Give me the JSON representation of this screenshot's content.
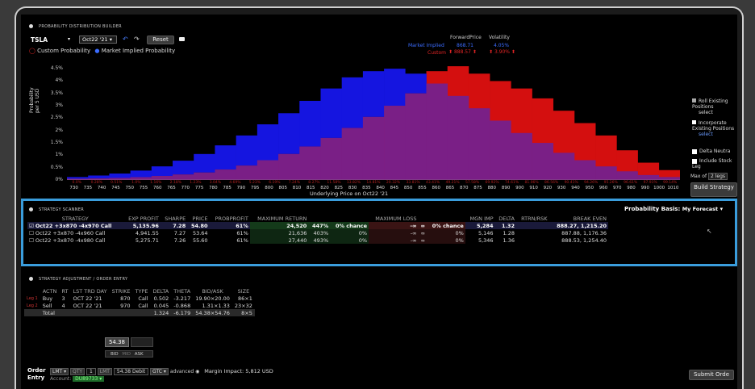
{
  "builder": {
    "header": "PROBABILITY DISTRIBUTION BUILDER",
    "symbol": "TSLA",
    "expiry": "Oct22 '21",
    "reset_label": "Reset",
    "legend_custom": "Custom Probability",
    "legend_market": "Market Implied Probability",
    "forward_price_label": "ForwardPrice",
    "volatility_label": "Volatility",
    "market_implied_label": "Market Implied",
    "market_forward": "868.71",
    "market_vol": "4.05%",
    "custom_label": "Custom",
    "custom_forward": "888.57",
    "custom_vol": "3.90%",
    "ylabel": "Probability\nper 5 USD",
    "xlabel": "Underlying Price on Oct22 '21",
    "side_options": [
      {
        "label": "Roll Existing Positions",
        "link": "select"
      },
      {
        "label": "Incorporate Existing Positions",
        "link": "select"
      }
    ],
    "delta_neutral": "Delta Neutra",
    "include_stock": "Include Stock Leg",
    "max_of": "Max of",
    "max_legs": "2 legs",
    "build_label": "Build Strategy"
  },
  "chart_data": {
    "type": "bar",
    "y_ticks": [
      "4.5%",
      "4%",
      "3.5%",
      "3%",
      "2.5%",
      "2%",
      "1.5%",
      "1%",
      "0.5%",
      "0%"
    ],
    "ylim": [
      0,
      4.7
    ],
    "x_labels": [
      "730",
      "735",
      "740",
      "745",
      "750",
      "755",
      "760",
      "765",
      "770",
      "775",
      "780",
      "785",
      "790",
      "795",
      "800",
      "805",
      "810",
      "815",
      "820",
      "825",
      "830",
      "835",
      "840",
      "845",
      "850",
      "855",
      "860",
      "865",
      "870",
      "875",
      "880",
      "890",
      "900",
      "910",
      "920",
      "930",
      "940",
      "950",
      "960",
      "970",
      "980",
      "990",
      "1000",
      "1010"
    ],
    "categories": [
      "730",
      "740",
      "750",
      "760",
      "770",
      "780",
      "790",
      "800",
      "810",
      "820",
      "830",
      "840",
      "850",
      "860",
      "870",
      "880",
      "890",
      "900",
      "910",
      "920",
      "930",
      "940",
      "950",
      "960",
      "970",
      "980",
      "990",
      "1000",
      "1010"
    ],
    "series": [
      {
        "name": "Custom Probability",
        "color": "#d40f0f",
        "values": [
          0.05,
          0.06,
          0.08,
          0.11,
          0.16,
          0.22,
          0.3,
          0.42,
          0.58,
          0.8,
          1.05,
          1.35,
          1.7,
          2.1,
          2.55,
          3.0,
          3.5,
          4.4,
          4.6,
          4.3,
          4.0,
          3.7,
          3.3,
          2.8,
          2.3,
          1.8,
          1.2,
          0.7,
          0.4
        ]
      },
      {
        "name": "Market Implied Probability",
        "color": "#1515e0",
        "values": [
          0.12,
          0.18,
          0.26,
          0.38,
          0.55,
          0.78,
          1.05,
          1.4,
          1.8,
          2.25,
          2.7,
          3.2,
          3.7,
          4.15,
          4.4,
          4.5,
          4.3,
          3.9,
          3.4,
          2.9,
          2.4,
          1.9,
          1.5,
          1.1,
          0.8,
          0.55,
          0.35,
          0.2,
          0.12
        ]
      }
    ],
    "percent_labels": [
      "0.0%",
      "0.28%",
      "0.51%",
      "1.0%",
      "1.16%",
      "2.18%",
      "1.23%",
      "3.04%",
      "4.69%",
      "5.23%",
      "6.19%",
      "7.24%",
      "8.27%",
      "11.58%",
      "13.82%",
      "14.81%",
      "20.32%",
      "33.81%",
      "43.41%",
      "49.21%",
      "57.58%",
      "69.92%",
      "74.61%",
      "81.06%",
      "86.56%",
      "90.41%",
      "94.26%",
      "95.26%",
      "96.61%",
      "97.91%",
      "99.14%"
    ]
  },
  "scanner": {
    "header": "STRATEGY SCANNER",
    "basis_label": "Probability Basis:",
    "basis_value": "My Forecast",
    "columns": [
      "STRATEGY",
      "EXP PROFIT",
      "SHARPE",
      "PRICE",
      "PROBPROFIT",
      "MAXIMUM RETURN",
      "",
      "",
      "MAXIMUM LOSS",
      "",
      "",
      "MGN IMP",
      "DELTA",
      "RTRN/RSK",
      "BREAK EVEN"
    ],
    "rows": [
      {
        "strategy": "Oct22 +3x870 -4x970 Call",
        "exp_profit": "5,135.96",
        "sharpe": "7.28",
        "price": "54.80",
        "probprofit": "61%",
        "max_return": "24,520",
        "ret_pct": "447%",
        "ret_chance": "0%  chance",
        "max_loss": "-∞",
        "loss_inf": "∞",
        "loss_chance": "0%  chance",
        "mgn": "5,284",
        "delta": "1.32",
        "rr": "",
        "be": "888.27, 1,215.20"
      },
      {
        "strategy": "Oct22 +3x870 -4x960 Call",
        "exp_profit": "4,941.55",
        "sharpe": "7.27",
        "price": "53.64",
        "probprofit": "61%",
        "max_return": "21,636",
        "ret_pct": "403%",
        "ret_chance": "0%",
        "max_loss": "-∞",
        "loss_inf": "∞",
        "loss_chance": "0%",
        "mgn": "5,146",
        "delta": "1.28",
        "rr": "",
        "be": "887.88, 1,176.36"
      },
      {
        "strategy": "Oct22 +3x870 -4x980 Call",
        "exp_profit": "5,275.71",
        "sharpe": "7.26",
        "price": "55.60",
        "probprofit": "61%",
        "max_return": "27,440",
        "ret_pct": "493%",
        "ret_chance": "0%",
        "max_loss": "-∞",
        "loss_inf": "∞",
        "loss_chance": "0%",
        "mgn": "5,346",
        "delta": "1.36",
        "rr": "",
        "be": "888.53, 1,254.40"
      }
    ]
  },
  "adjustment": {
    "header": "STRATEGY ADJUSTMENT / ORDER ENTRY",
    "columns": [
      "",
      "ACTN",
      "RT",
      "LST TRD DAY",
      "STRIKE",
      "TYPE",
      "DELTA",
      "THETA",
      "BID/ASK",
      "SIZE"
    ],
    "legs": [
      {
        "leg": "Leg 1",
        "actn": "Buy",
        "rt": "3",
        "day": "OCT 22 '21",
        "strike": "870",
        "type": "Call",
        "delta": "0.502",
        "theta": "-3.217",
        "bidask": "19.90×20.00",
        "size": "86×1"
      },
      {
        "leg": "Leg 2",
        "actn": "Sell",
        "rt": "4",
        "day": "OCT 22 '21",
        "strike": "970",
        "type": "Call",
        "delta": "0.045",
        "theta": "-0.868",
        "bidask": "1.31×1.33",
        "size": "23×32"
      }
    ],
    "total": {
      "label": "Total",
      "delta": "1.324",
      "theta": "-6.179",
      "bidask": "54.38×54.76",
      "size": "8×5"
    },
    "price_box": "54.38",
    "bid": "BID",
    "mid": "MID",
    "ask": "ASK"
  },
  "order": {
    "order_label": "Order",
    "entry_label": "Entry",
    "lmt": "LMT",
    "qty": "QTY",
    "qty_val": "1",
    "lmt2": "LMT",
    "debit": "54.38 Debit",
    "gtc": "GTC",
    "advanced": "advanced",
    "margin": "Margin Impact: 5,812 USD",
    "account_label": "Account:",
    "account": "DU89733",
    "submit": "Submit Orde"
  }
}
